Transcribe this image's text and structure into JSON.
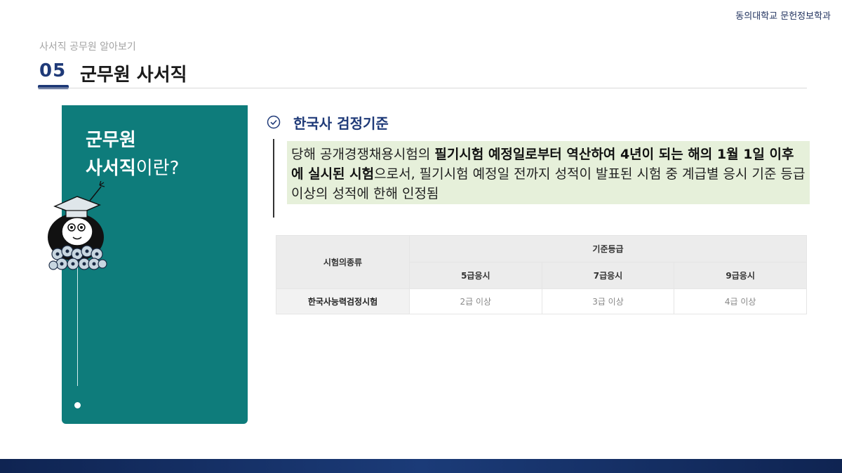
{
  "header": {
    "university": "동의대학교 문헌정보학과",
    "subtitle": "사서직 공무원 알아보기",
    "section_number": "05",
    "section_title": "군무원 사서직"
  },
  "sidebar_card": {
    "line1": "군무원",
    "line2_bold": "사서직",
    "line2_rest": "이란?",
    "color": "#0e7c7b"
  },
  "content": {
    "check_icon": "check-circle-icon",
    "heading": "한국사 검정기준",
    "text_part1": "당해 공개경쟁채용시험의 ",
    "text_bold": "필기시험 예정일로부터 역산하여 4년이 되는 해의 1월 1일 이후에 실시된 시험",
    "text_part2": "으로서, 필기시험 예정일 전까지 성적이 발표된 시험 중 계급별 응시 기준 등급 이상의 성적에 한해 인정됨",
    "highlight_color": "#e6f0da"
  },
  "table": {
    "row_header": "시험의종류",
    "group_header": "기준등급",
    "columns": [
      "5급응시",
      "7급응시",
      "9급응시"
    ],
    "rows": [
      {
        "exam": "한국사능력검정시험",
        "values": [
          "2급 이상",
          "3급 이상",
          "4급 이상"
        ]
      }
    ]
  },
  "colors": {
    "navy": "#1f3a78",
    "teal": "#0e7c7b",
    "footer": "#142d62"
  }
}
